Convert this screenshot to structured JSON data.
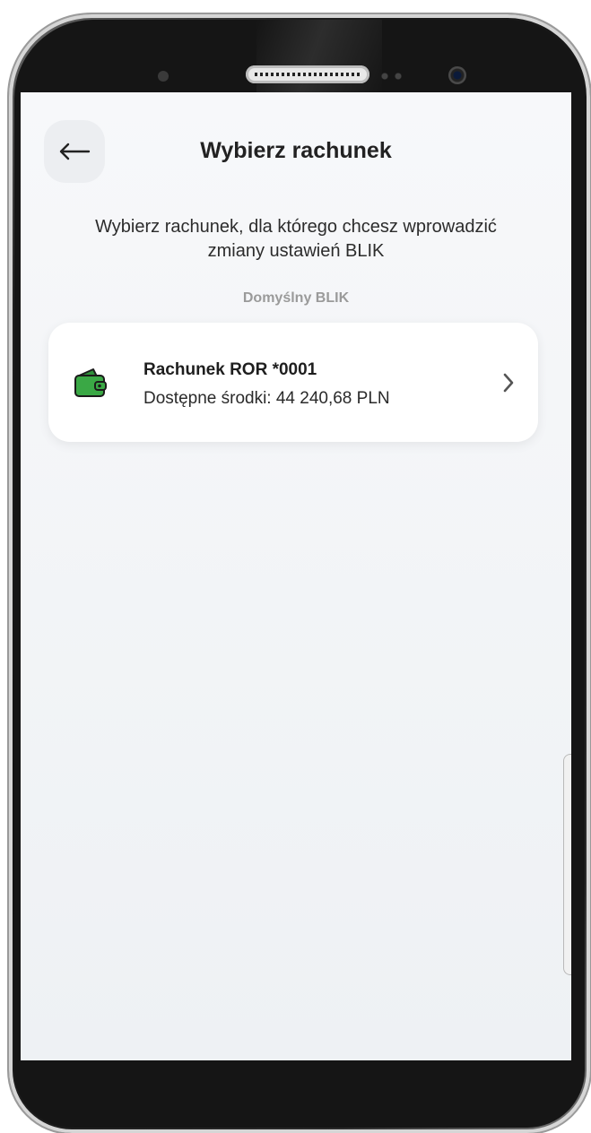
{
  "header": {
    "title": "Wybierz rachunek",
    "back_icon": "arrow-left-icon"
  },
  "main": {
    "description": "Wybierz rachunek, dla którego chcesz wprowadzić zmiany ustawień BLIK",
    "section_label": "Domyślny BLIK",
    "accounts": [
      {
        "icon": "wallet-icon",
        "name": "Rachunek ROR *0001",
        "balance": "Dostępne środki: 44 240,68 PLN"
      }
    ]
  },
  "colors": {
    "wallet_green": "#3aa845",
    "screen_background": "#f4f6f8",
    "card_background": "#ffffff"
  }
}
